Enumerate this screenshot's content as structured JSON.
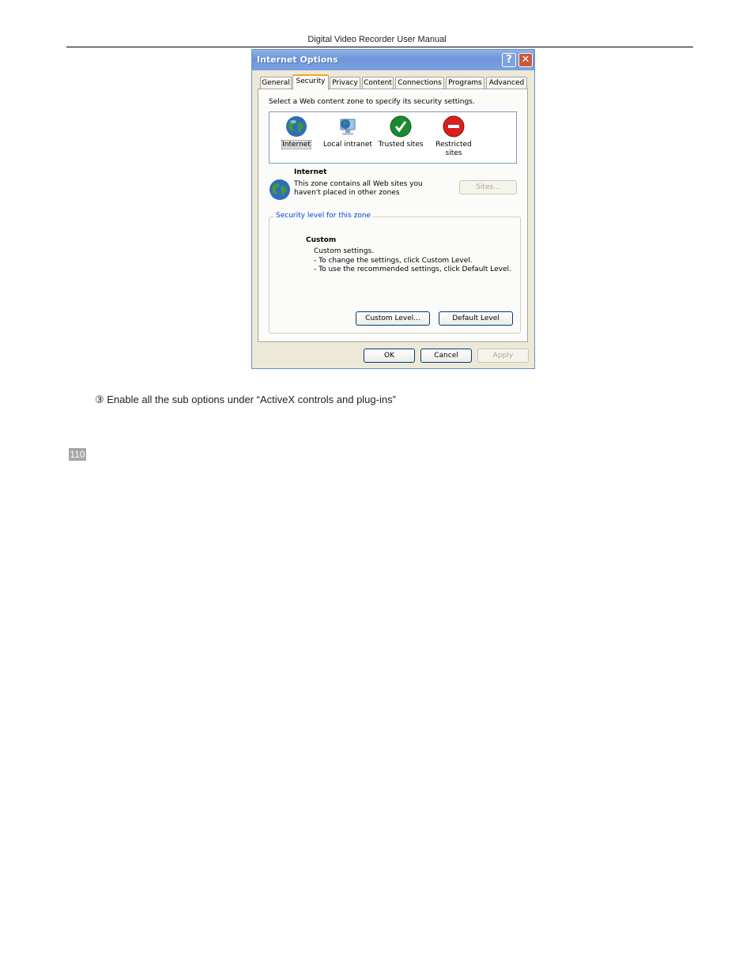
{
  "page": {
    "header": "Digital Video Recorder User Manual",
    "instruction": "③  Enable all the sub options under “ActiveX controls and plug-ins”",
    "page_number": "110"
  },
  "dialog": {
    "title": "Internet Options",
    "help_glyph": "?",
    "close_glyph": "✕",
    "tabs": [
      "General",
      "Security",
      "Privacy",
      "Content",
      "Connections",
      "Programs",
      "Advanced"
    ],
    "active_tab": "Security",
    "select_label": "Select a Web content zone to specify its security settings.",
    "zones": [
      {
        "label": "Internet",
        "icon": "globe-icon",
        "selected": true
      },
      {
        "label": "Local intranet",
        "icon": "computer-globe-icon",
        "selected": false
      },
      {
        "label": "Trusted sites",
        "icon": "checkmark-icon",
        "selected": false
      },
      {
        "label": "Restricted sites",
        "icon": "no-entry-icon",
        "selected": false
      }
    ],
    "zone_info": {
      "title": "Internet",
      "description": "This zone contains all Web sites you haven't placed in other zones",
      "sites_button": "Sites..."
    },
    "security_level": {
      "group_label": "Security level for this zone",
      "level_title": "Custom",
      "lines": [
        "Custom settings.",
        "- To change the settings, click Custom Level.",
        "- To use the recommended settings, click Default Level."
      ],
      "custom_level_button": "Custom Level...",
      "default_level_button": "Default Level"
    },
    "buttons": {
      "ok": "OK",
      "cancel": "Cancel",
      "apply": "Apply"
    },
    "colors": {
      "titlebar": "#7ba2e0",
      "trusted": "#1a8a2e",
      "restricted": "#d81e1e"
    }
  }
}
